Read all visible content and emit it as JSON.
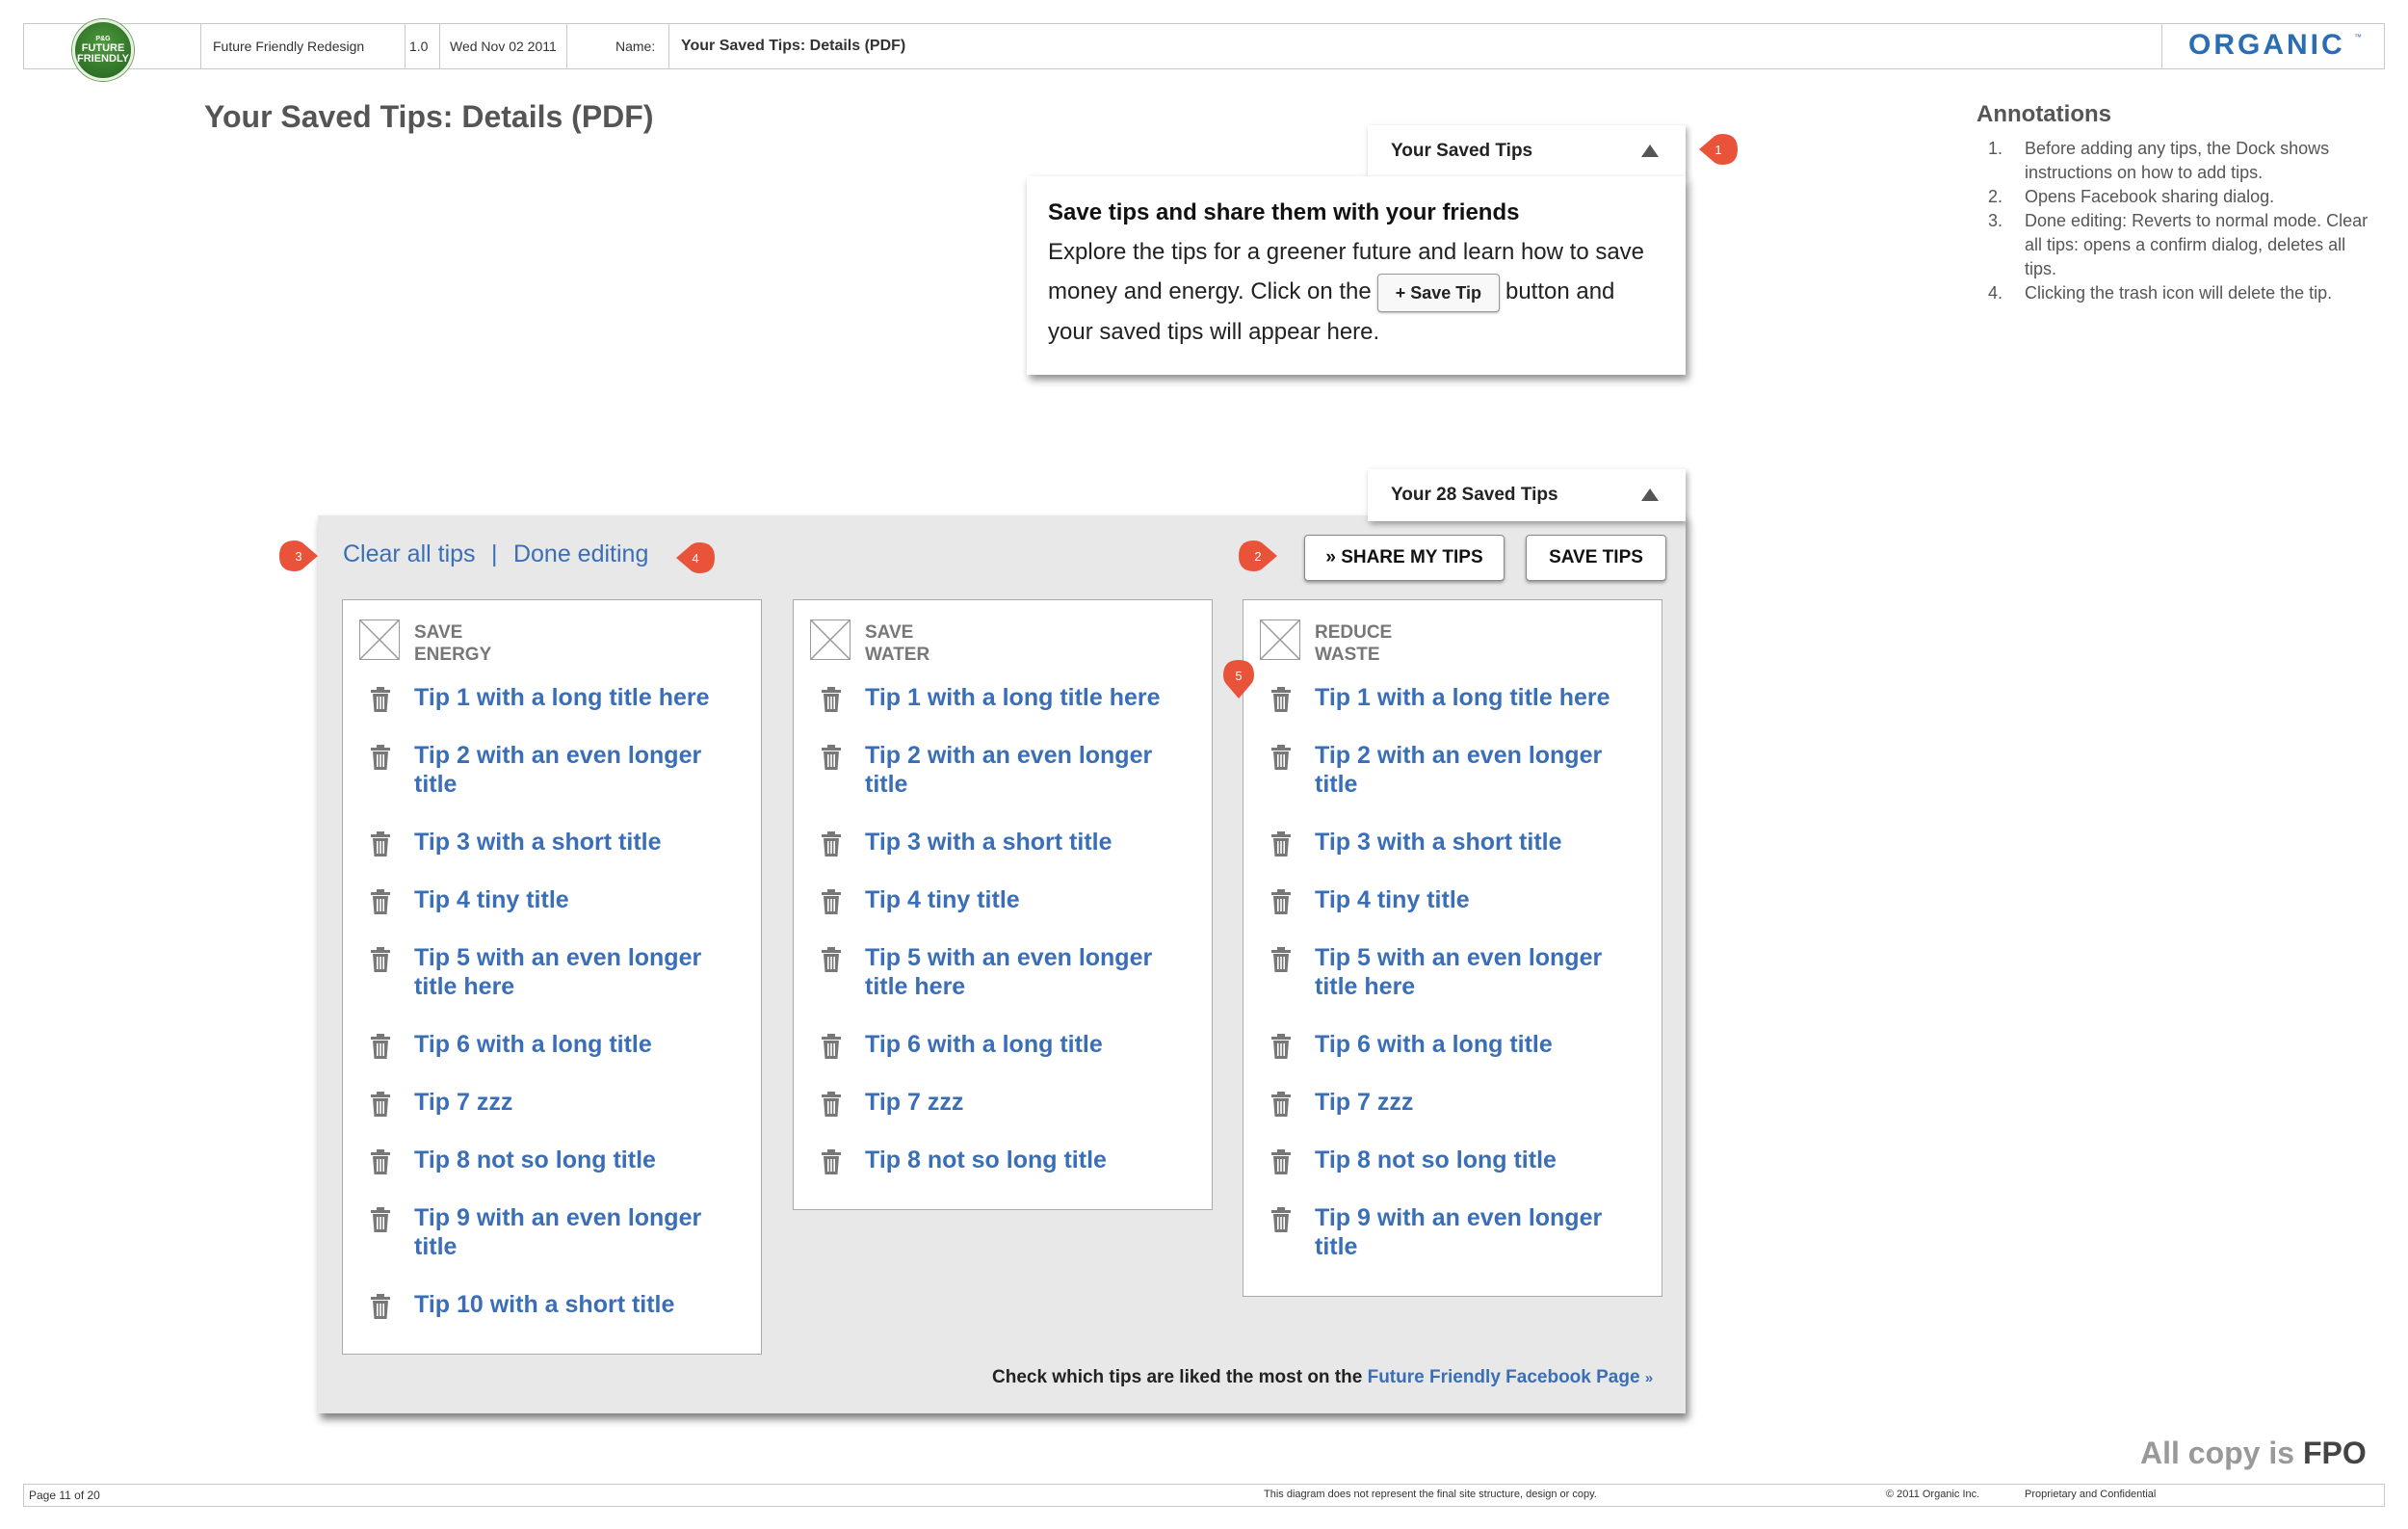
{
  "header": {
    "logo": {
      "line1": "FUTURE",
      "line2": "FRIENDLY",
      "small": "P&G"
    },
    "project": "Future Friendly Redesign",
    "version": "1.0",
    "date": "Wed Nov 02 2011",
    "name_label": "Name:",
    "name_value": "Your Saved Tips: Details (PDF)",
    "brand": "ORGANIC",
    "brand_tm": "™"
  },
  "page_title": "Your Saved Tips: Details (PDF)",
  "annotations": {
    "title": "Annotations",
    "items": [
      {
        "num": "1.",
        "text": "Before adding any tips, the Dock shows instructions on how to add tips."
      },
      {
        "num": "2.",
        "text": "Opens Facebook sharing dialog."
      },
      {
        "num": "3.",
        "text": "Done editing: Reverts to normal mode. Clear all tips: opens a confirm dialog, deletes all tips."
      },
      {
        "num": "4.",
        "text": "Clicking the trash icon will delete the tip."
      }
    ]
  },
  "empty_dock": {
    "tab_label": "Your Saved Tips",
    "heading": "Save tips and share them with your friends",
    "text_before": "Explore the tips for a greener future and learn how to save money and energy. Click on the",
    "button_label": "+ Save Tip",
    "text_after": "button and your saved tips will appear here."
  },
  "dock": {
    "tab_label": "Your 28 Saved Tips",
    "clear_all": "Clear all tips",
    "separator": "|",
    "done_editing": "Done editing",
    "share_button": "» SHARE MY TIPS",
    "save_button": "SAVE TIPS",
    "columns": [
      {
        "category_line1": "SAVE",
        "category_line2": "ENERGY",
        "tips": [
          "Tip 1 with a long title here",
          "Tip 2 with an even longer title",
          "Tip 3 with a short title",
          "Tip 4 tiny title",
          "Tip 5 with an even longer title here",
          "Tip 6 with a long title",
          "Tip 7 zzz",
          "Tip 8 not so long title",
          "Tip 9 with an even longer title",
          "Tip 10 with a short title"
        ]
      },
      {
        "category_line1": "SAVE",
        "category_line2": "WATER",
        "tips": [
          "Tip 1 with a long title here",
          "Tip 2 with an even longer title",
          "Tip 3 with a short title",
          "Tip 4 tiny title",
          "Tip 5 with an even longer title here",
          "Tip 6 with a long title",
          "Tip 7 zzz",
          "Tip 8 not so long title"
        ]
      },
      {
        "category_line1": "REDUCE",
        "category_line2": "WASTE",
        "tips": [
          "Tip 1 with a long title here",
          "Tip 2 with an even longer title",
          "Tip 3 with a short title",
          "Tip 4 tiny title",
          "Tip 5 with an even longer title here",
          "Tip 6 with a long title",
          "Tip 7 zzz",
          "Tip 8 not so long title",
          "Tip 9 with an even longer title"
        ]
      }
    ],
    "footer_text": "Check which tips are liked the most on the",
    "footer_link": "Future Friendly Facebook Page",
    "footer_link_arrow": "»"
  },
  "markers": [
    "1",
    "2",
    "3",
    "4",
    "5"
  ],
  "fpo": {
    "prefix": "All copy is",
    "emph": "FPO"
  },
  "footer": {
    "page": "Page 11 of 20",
    "disclaimer": "This diagram does not represent the final site structure, design or copy.",
    "copyright": "© 2011 Organic Inc.",
    "confidential": "Proprietary and Confidential"
  },
  "colors": {
    "link": "#3a6fb7",
    "marker": "#e8533a",
    "brand": "#2a6db5",
    "panel": "#e8e8e8"
  }
}
